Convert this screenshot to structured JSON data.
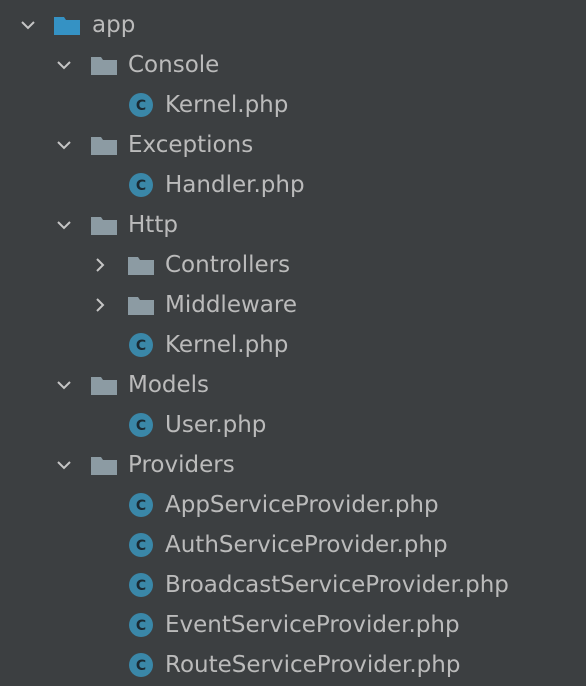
{
  "tree": {
    "app": {
      "label": "app",
      "expanded": true,
      "icon": "folder-blue-icon"
    },
    "console": {
      "label": "Console",
      "expanded": true,
      "icon": "folder-icon"
    },
    "console_kernel": {
      "label": "Kernel.php",
      "icon": "php-class-icon"
    },
    "exceptions": {
      "label": "Exceptions",
      "expanded": true,
      "icon": "folder-icon"
    },
    "exceptions_handler": {
      "label": "Handler.php",
      "icon": "php-class-icon"
    },
    "http": {
      "label": "Http",
      "expanded": true,
      "icon": "folder-icon"
    },
    "controllers": {
      "label": "Controllers",
      "expanded": false,
      "icon": "folder-icon"
    },
    "middleware": {
      "label": "Middleware",
      "expanded": false,
      "icon": "folder-icon"
    },
    "http_kernel": {
      "label": "Kernel.php",
      "icon": "php-class-icon"
    },
    "models": {
      "label": "Models",
      "expanded": true,
      "icon": "folder-icon"
    },
    "user": {
      "label": "User.php",
      "icon": "php-class-icon"
    },
    "providers": {
      "label": "Providers",
      "expanded": true,
      "icon": "folder-icon"
    },
    "app_sp": {
      "label": "AppServiceProvider.php",
      "icon": "php-class-icon"
    },
    "auth_sp": {
      "label": "AuthServiceProvider.php",
      "icon": "php-class-icon"
    },
    "broadcast_sp": {
      "label": "BroadcastServiceProvider.php",
      "icon": "php-class-icon"
    },
    "event_sp": {
      "label": "EventServiceProvider.php",
      "icon": "php-class-icon"
    },
    "route_sp": {
      "label": "RouteServiceProvider.php",
      "icon": "php-class-icon"
    }
  },
  "colors": {
    "background": "#3c3f41",
    "text": "#bbbbbb",
    "folder": "#8c9ba3",
    "root_folder": "#3592c4",
    "class_badge": "#3a87a8"
  },
  "badge_letter": "C"
}
